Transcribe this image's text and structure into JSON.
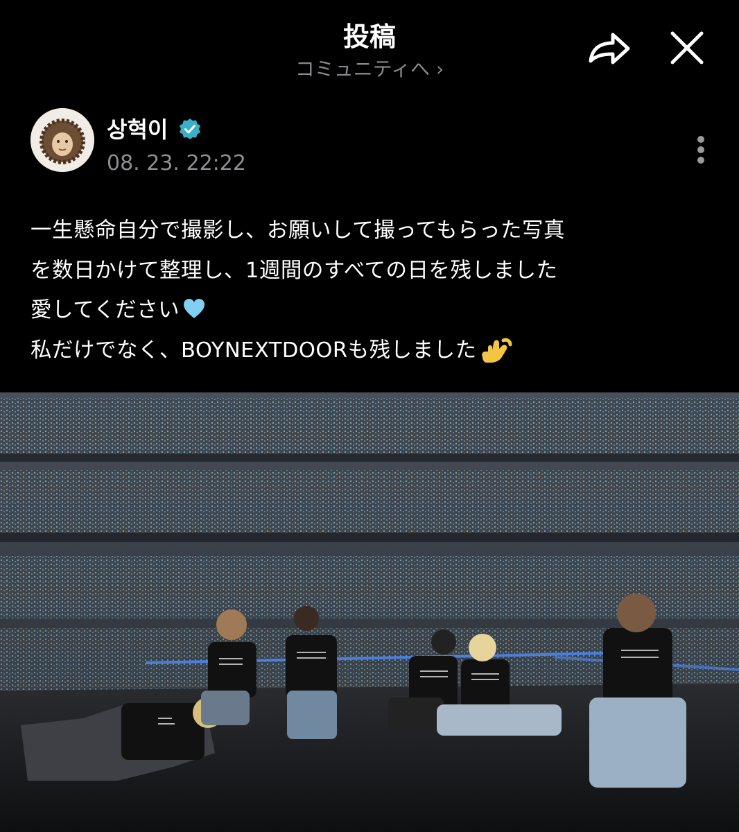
{
  "header": {
    "title": "投稿",
    "community_link": "コミュニティへ ›",
    "share_icon": "share-icon",
    "close_icon": "close-icon"
  },
  "post": {
    "author": {
      "name": "상혁이",
      "verified": true,
      "verified_color": "#3ab0c8"
    },
    "timestamp": "08. 23. 22:22",
    "body": {
      "line1": "一生懸命自分で撮影し、お願いして撮ってもらった写真",
      "line2": "を数日かけて整理し、1週間のすべての日を残しました",
      "line3": "愛してください",
      "line3_emoji": "light-blue-heart",
      "line4": "私だけでなく、BOYNEXTDOORも残しました",
      "line4_emoji": "call-me-hand"
    },
    "photo": {
      "alt_icon": "concert-group-photo"
    }
  },
  "colors": {
    "background": "#000000",
    "muted_text": "#8e8e93",
    "accent": "#3ab0c8"
  }
}
